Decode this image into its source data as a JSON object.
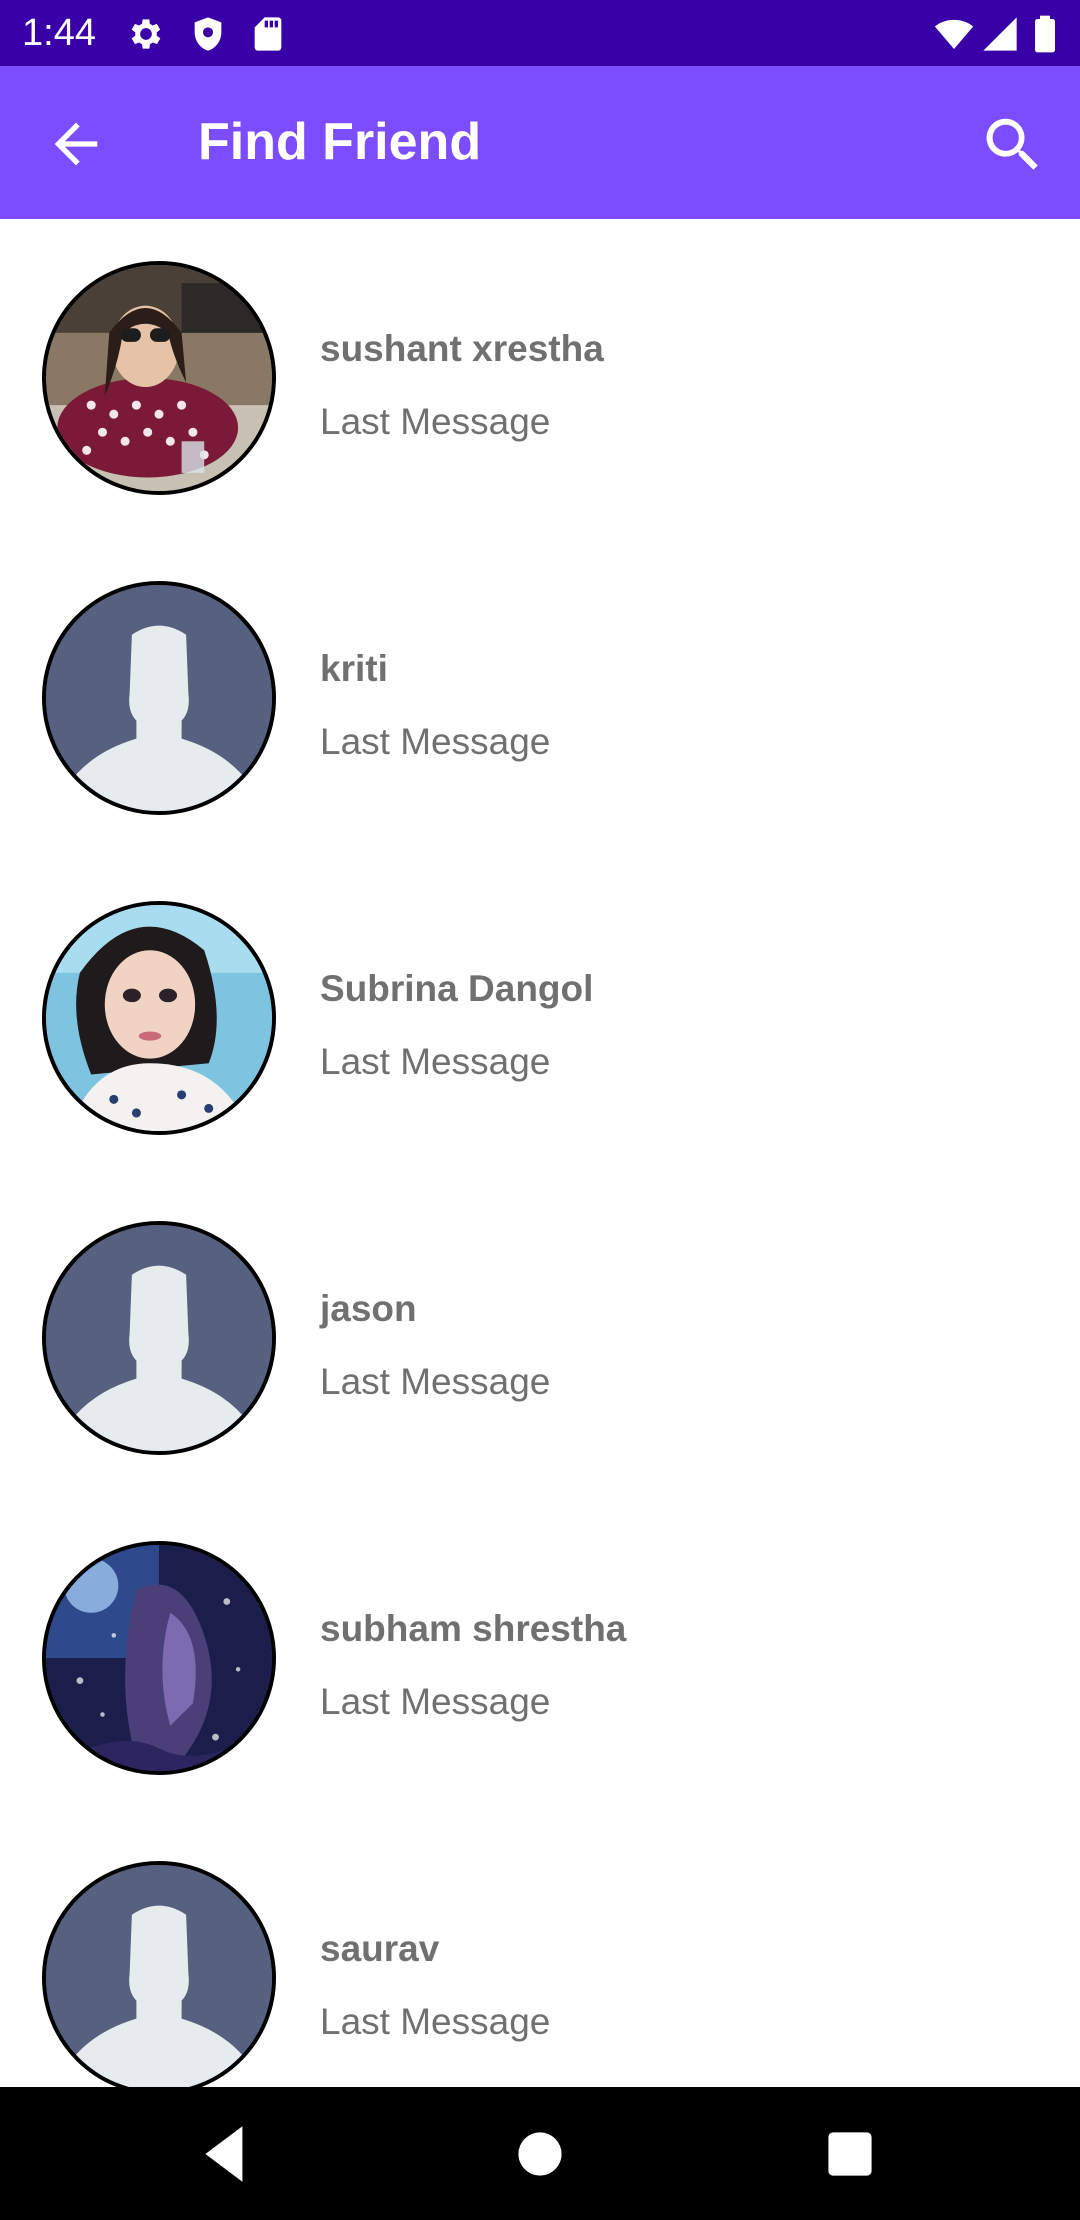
{
  "status_bar": {
    "time": "1:44",
    "icons": [
      "settings-icon",
      "shield-icon",
      "sd-card-icon",
      "wifi-icon",
      "signal-icon",
      "battery-icon"
    ],
    "background": "#3a00a8"
  },
  "app_bar": {
    "title": "Find Friend",
    "back_icon": "arrow-back-icon",
    "search_icon": "search-icon",
    "background": "#7c4dff"
  },
  "friends": [
    {
      "name": "sushant xrestha",
      "subtitle": "Last Message",
      "avatar": "photo-sunglasses"
    },
    {
      "name": "kriti",
      "subtitle": "Last Message",
      "avatar": "default-silhouette"
    },
    {
      "name": "Subrina Dangol",
      "subtitle": "Last Message",
      "avatar": "photo-selfie"
    },
    {
      "name": "jason",
      "subtitle": "Last Message",
      "avatar": "default-silhouette"
    },
    {
      "name": "subham shrestha",
      "subtitle": "Last Message",
      "avatar": "photo-anime"
    },
    {
      "name": "saurav",
      "subtitle": "Last Message",
      "avatar": "default-silhouette"
    }
  ],
  "nav_bar": {
    "buttons": [
      "back-triangle-icon",
      "home-circle-icon",
      "recents-square-icon"
    ]
  }
}
